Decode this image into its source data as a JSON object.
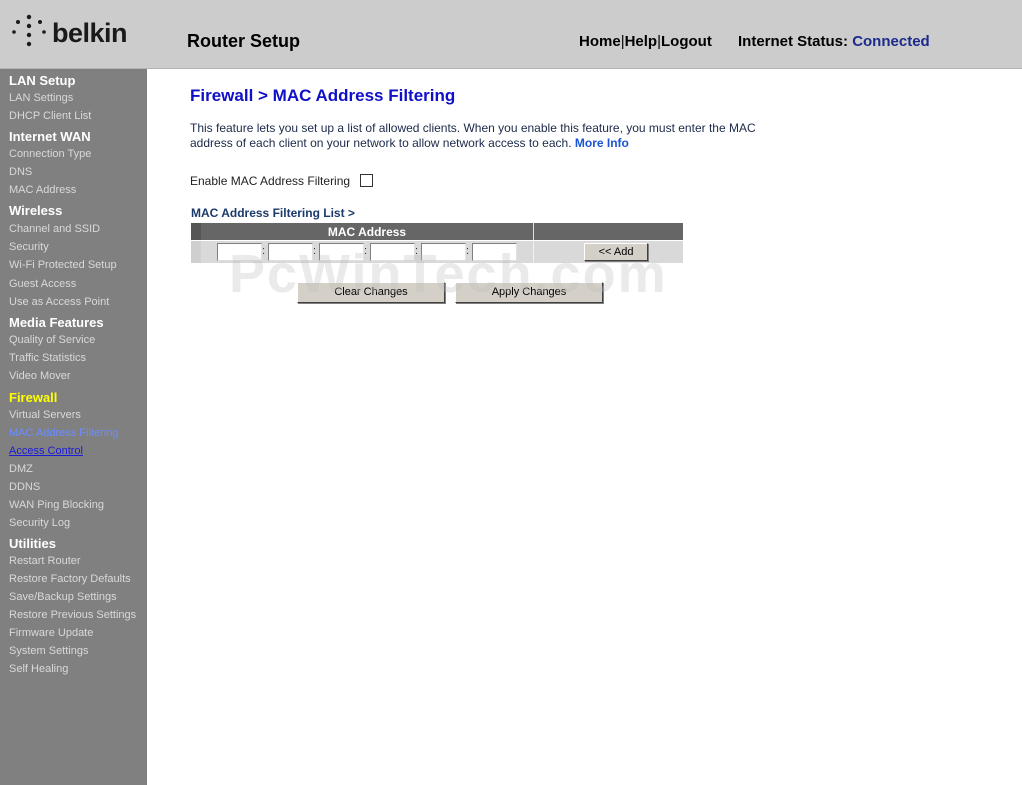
{
  "brand": "belkin",
  "header": {
    "title": "Router Setup",
    "links": [
      "Home",
      "Help",
      "Logout"
    ],
    "status_label": "Internet Status:",
    "status_value": "Connected"
  },
  "sidebar": {
    "lan_setup": "LAN Setup",
    "lan_settings": "LAN Settings",
    "dhcp_client_list": "DHCP Client List",
    "internet_wan": "Internet WAN",
    "connection_type": "Connection Type",
    "dns": "DNS",
    "mac_address": "MAC Address",
    "wireless": "Wireless",
    "channel_ssid": "Channel and SSID",
    "security": "Security",
    "wps": "Wi-Fi Protected Setup",
    "guest_access": "Guest Access",
    "access_point": "Use as Access Point",
    "media_features": "Media Features",
    "qos": "Quality of Service",
    "traffic_statistics": "Traffic Statistics",
    "video_mover": "Video Mover",
    "firewall": "Firewall",
    "virtual_servers": "Virtual Servers",
    "mac_filtering": "MAC Address Filtering",
    "access_control": "Access Control",
    "dmz": "DMZ",
    "ddns": "DDNS",
    "wan_ping_blocking": "WAN Ping Blocking",
    "security_log": "Security Log",
    "utilities": "Utilities",
    "restart_router": "Restart Router",
    "restore_factory": "Restore Factory Defaults",
    "save_backup": "Save/Backup Settings",
    "restore_previous": "Restore Previous Settings",
    "firmware_update": "Firmware Update",
    "system_settings": "System Settings",
    "self_healing": "Self Healing"
  },
  "main": {
    "title": "Firewall > MAC Address Filtering",
    "description": "This feature lets you set up a list of allowed clients. When you enable this feature, you must enter the MAC address of each client on your network to allow network access to each.",
    "more_info": "More Info",
    "enable_label": "Enable MAC Address Filtering",
    "enable_checked": false,
    "list_title": "MAC Address Filtering List >",
    "column_header": "MAC Address",
    "mac_octets": [
      "",
      "",
      "",
      "",
      "",
      ""
    ],
    "separator": ":",
    "add_button": "<< Add",
    "clear_button": "Clear Changes",
    "apply_button": "Apply Changes"
  },
  "watermark": "PcWinTech.com"
}
